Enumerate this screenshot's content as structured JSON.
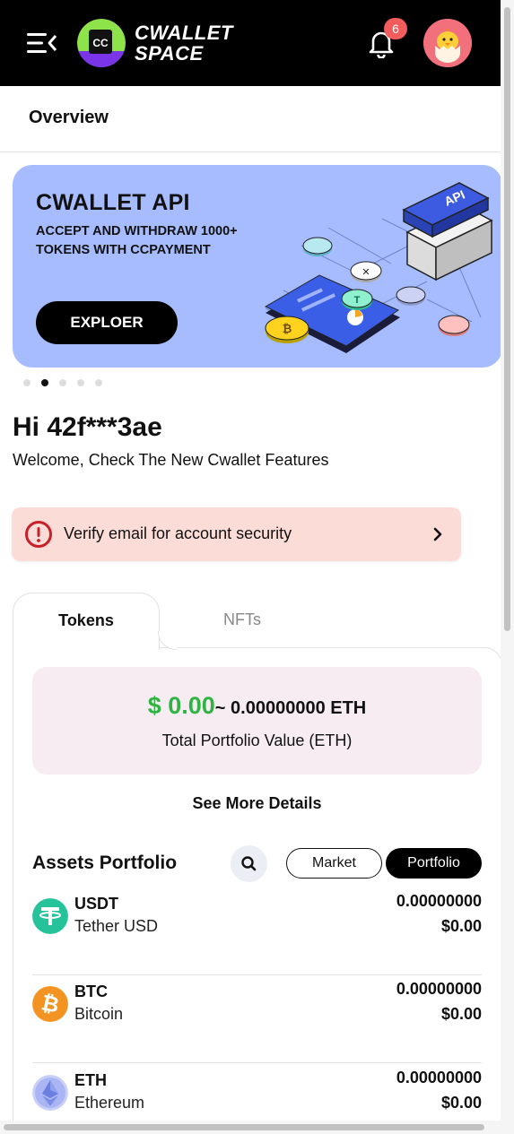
{
  "header": {
    "logo_line1": "CWALLET",
    "logo_line2": "SPACE",
    "logo_mark_text": "CC",
    "notification_count": "6",
    "colors": {
      "background": "#000000",
      "badge": "#f25c5c",
      "logo_green": "#8ee34b",
      "logo_purple": "#7a35e8"
    }
  },
  "overview": {
    "title": "Overview"
  },
  "banner": {
    "title": "CWALLET API",
    "subtitle": "ACCEPT AND WITHDRAW 1000+ TOKENS WITH CCPAYMENT",
    "button": "EXPLOER",
    "art_label": "API",
    "slide_count": 5,
    "active_slide": 2,
    "colors": {
      "background": "#a7bcff"
    }
  },
  "greeting": {
    "hi": "Hi 42f***3ae",
    "welcome": "Welcome, Check The New Cwallet Features"
  },
  "verify_alert": {
    "text": "Verify email for account security",
    "icon": "alert-circle-icon",
    "colors": {
      "background": "#fcdcd6",
      "icon": "#c8202b"
    }
  },
  "tabs": [
    {
      "label": "Tokens",
      "active": true
    },
    {
      "label": "NFTs",
      "active": false
    }
  ],
  "portfolio": {
    "usd_value": "$ 0.00",
    "eth_value": "~ 0.00000000 ETH",
    "label": "Total Portfolio Value (ETH)",
    "colors": {
      "card": "#f6ecf1",
      "usd": "#2fb444"
    }
  },
  "see_more": "See More Details",
  "assets": {
    "title": "Assets Portfolio",
    "toggle": [
      "Market",
      "Portfolio"
    ],
    "selected_toggle": "Portfolio",
    "items": [
      {
        "symbol": "USDT",
        "name": "Tether USD",
        "amount": "0.00000000",
        "value": "$0.00",
        "icon": "tether-icon",
        "color": "#26c29a"
      },
      {
        "symbol": "BTC",
        "name": "Bitcoin",
        "amount": "0.00000000",
        "value": "$0.00",
        "icon": "bitcoin-icon",
        "color": "#f39321"
      },
      {
        "symbol": "ETH",
        "name": "Ethereum",
        "amount": "0.00000000",
        "value": "$0.00",
        "icon": "ethereum-icon",
        "color": "#8a9bf0"
      }
    ]
  }
}
